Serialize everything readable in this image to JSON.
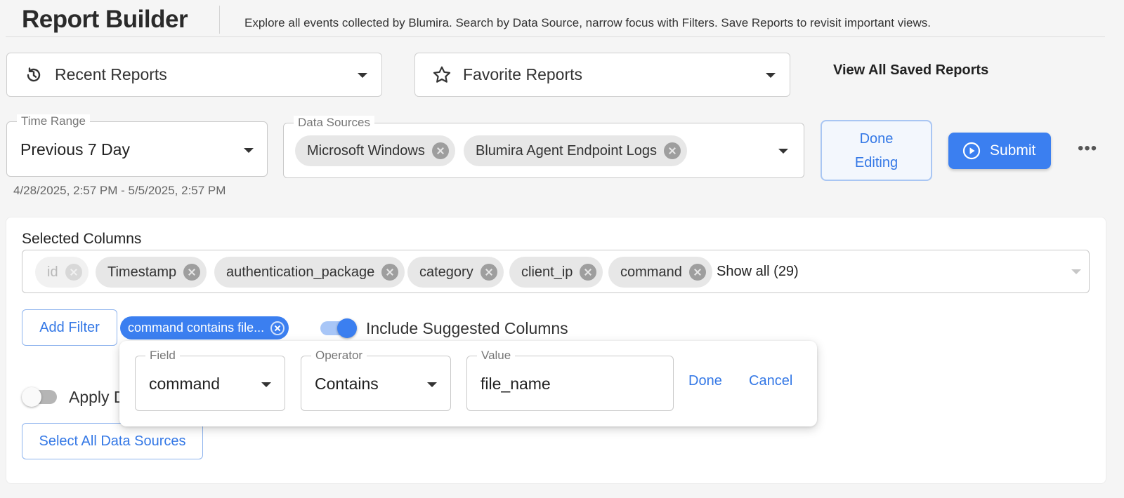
{
  "header": {
    "title": "Report Builder",
    "description": "Explore all events collected by Blumira. Search by Data Source, narrow focus with Filters. Save Reports to revisit important views."
  },
  "reports": {
    "recent_label": "Recent Reports",
    "recent_icon": "history-icon",
    "favorite_label": "Favorite Reports",
    "favorite_icon": "star-icon",
    "view_all_label": "View All Saved Reports"
  },
  "time_range": {
    "legend": "Time Range",
    "value": "Previous 7 Day",
    "hint": "4/28/2025, 2:57 PM - 5/5/2025, 2:57 PM"
  },
  "data_sources": {
    "legend": "Data Sources",
    "selected": [
      "Microsoft Windows",
      "Blumira Agent Endpoint Logs"
    ]
  },
  "actions": {
    "done_editing_line1": "Done",
    "done_editing_line2": "Editing",
    "submit_label": "Submit",
    "more_label": "•••"
  },
  "columns": {
    "label": "Selected Columns",
    "chips": [
      {
        "label": "id",
        "disabled": true
      },
      {
        "label": "Timestamp"
      },
      {
        "label": "authentication_package"
      },
      {
        "label": "category"
      },
      {
        "label": "client_ip"
      },
      {
        "label": "command"
      }
    ],
    "show_all_label": "Show all (29)"
  },
  "filters": {
    "add_filter_label": "Add Filter",
    "active_filter_label": "command contains file...",
    "include_suggested_label": "Include Suggested Columns",
    "include_suggested_on": true,
    "apply_label_partial": "Apply D",
    "apply_on": false,
    "select_all_label": "Select All Data Sources"
  },
  "filter_editor": {
    "field_legend": "Field",
    "field_value": "command",
    "operator_legend": "Operator",
    "operator_value": "Contains",
    "value_legend": "Value",
    "value_value": "file_name",
    "done_label": "Done",
    "cancel_label": "Cancel"
  },
  "colors": {
    "accent": "#3b7ff0",
    "accent_text": "#3478e6",
    "chip_bg": "#e7e7e7"
  }
}
